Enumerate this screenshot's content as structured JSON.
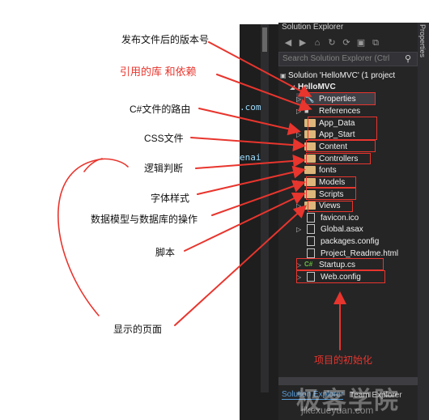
{
  "panel": {
    "title": "Solution Explorer",
    "search_placeholder": "Search Solution Explorer (Ctrl",
    "right_tab": "Properties",
    "solution_line": "Solution 'HelloMVC' (1 project",
    "project": "HelloMVC",
    "items": [
      {
        "label": "Properties",
        "kind": "wrench"
      },
      {
        "label": "References",
        "kind": "ref"
      },
      {
        "label": "App_Data",
        "kind": "folder"
      },
      {
        "label": "App_Start",
        "kind": "folder"
      },
      {
        "label": "Content",
        "kind": "folder"
      },
      {
        "label": "Controllers",
        "kind": "folder"
      },
      {
        "label": "fonts",
        "kind": "folder"
      },
      {
        "label": "Models",
        "kind": "folder"
      },
      {
        "label": "Scripts",
        "kind": "folder"
      },
      {
        "label": "Views",
        "kind": "folder"
      },
      {
        "label": "favicon.ico",
        "kind": "file"
      },
      {
        "label": "Global.asax",
        "kind": "file"
      },
      {
        "label": "packages.config",
        "kind": "file"
      },
      {
        "label": "Project_Readme.html",
        "kind": "file"
      },
      {
        "label": "Startup.cs",
        "kind": "cs"
      },
      {
        "label": "Web.config",
        "kind": "file"
      }
    ],
    "tabs": {
      "solution_explorer": "Solution Explorer",
      "team_explorer": "Team Explorer"
    }
  },
  "code_fragments": {
    "frag1": ".com",
    "frag2": "enai"
  },
  "annotations": {
    "version": "发布文件后的版本号",
    "references": "引用的库 和依赖",
    "route": "C#文件的路由",
    "css": "CSS文件",
    "logic": "逻辑判断",
    "fonts": "字体样式",
    "models": "数据模型与数据库的操作",
    "scripts": "脚本",
    "views": "显示的页面",
    "init": "项目的初始化"
  },
  "watermark": {
    "main": "极客学院",
    "sub": "jikexueyuan.com"
  },
  "colors": {
    "accent_red": "#e8352d",
    "folder": "#dcb67a",
    "panel_bg": "#252526"
  }
}
